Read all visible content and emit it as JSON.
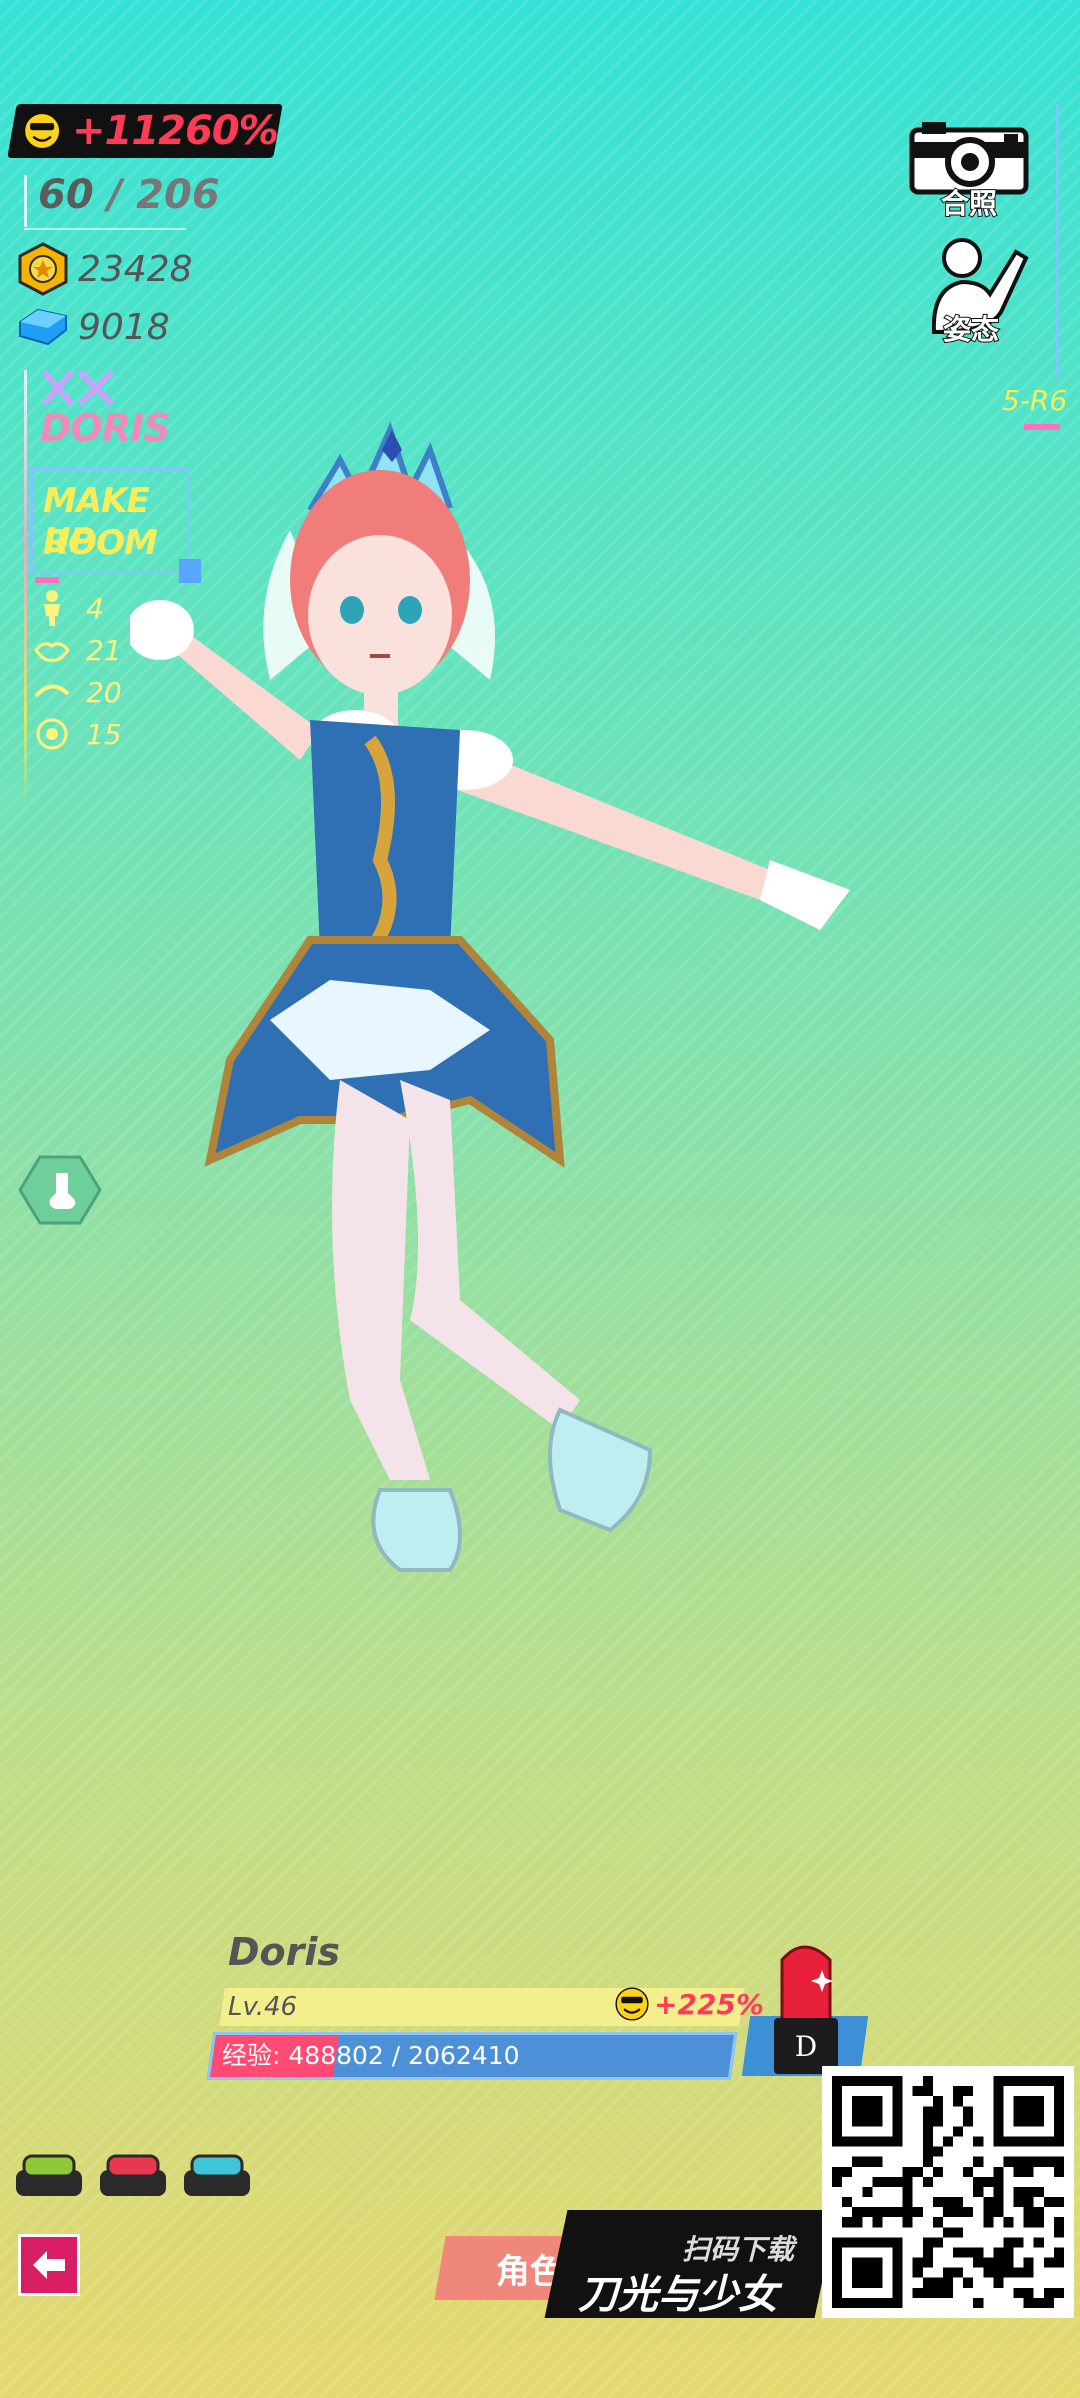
{
  "hud": {
    "boost_percent": "+11260%",
    "outfit_count": "60",
    "outfit_separator": "/",
    "outfit_total": "206",
    "gold": "23428",
    "diamonds": "9018",
    "character_code": "DORIS",
    "room_line1": "MAKE UP",
    "room_line2": "ROOM",
    "stats": [
      {
        "icon": "body-icon",
        "value": "4"
      },
      {
        "icon": "lips-icon",
        "value": "21"
      },
      {
        "icon": "eyebrow-icon",
        "value": "20"
      },
      {
        "icon": "eye-icon",
        "value": "15"
      }
    ]
  },
  "right_hud": {
    "photo_label": "合照",
    "pose_label": "姿态",
    "stage": "5-R6"
  },
  "character": {
    "name": "Doris",
    "level": "Lv.46",
    "level_boost": "+225%",
    "exp_label": "经验:",
    "exp_current": "488802",
    "exp_total": "2062410",
    "exp_fraction": 0.237,
    "lipstick_letter": "D"
  },
  "swatches": [
    {
      "name": "swatch-green",
      "color": "#8fc83b"
    },
    {
      "name": "swatch-red",
      "color": "#e8374f"
    },
    {
      "name": "swatch-cyan",
      "color": "#3fc5d8"
    }
  ],
  "bottom": {
    "role_tab": "角色",
    "scan_text": "扫码下载",
    "game_title": "刀光与少女"
  },
  "colors": {
    "accent_red": "#ff3b57",
    "accent_yellow": "#f6ef5a",
    "accent_blue": "#4c91d8"
  }
}
